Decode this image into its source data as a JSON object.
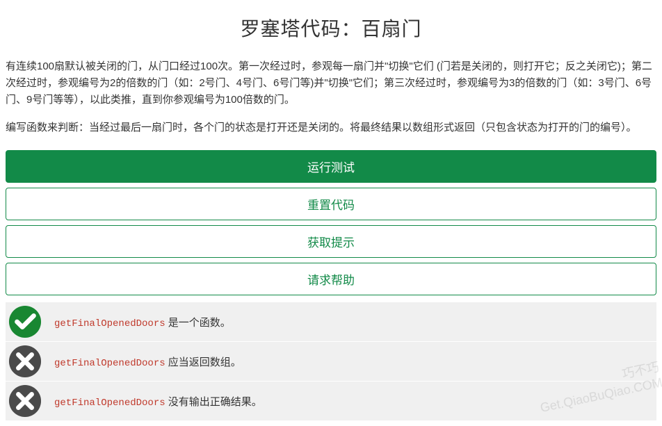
{
  "title": "罗塞塔代码：百扇门",
  "description": {
    "p1": "有连续100扇默认被关闭的门，从门口经过100次。第一次经过时，参观每一扇门并\"切换\"它们 (门若是关闭的，则打开它；反之关闭它)；第二次经过时，参观编号为2的倍数的门（如：2号门、4号门、6号门等)并\"切换\"它们；第三次经过时，参观编号为3的倍数的门（如：3号门、6号门、9号门等等），以此类推，直到你参观编号为100倍数的门。",
    "p2": "编写函数来判断：当经过最后一扇门时，各个门的状态是打开还是关闭的。将最终结果以数组形式返回（只包含状态为打开的门的编号）。"
  },
  "buttons": {
    "run": "运行测试",
    "reset": "重置代码",
    "hint": "获取提示",
    "help": "请求帮助"
  },
  "results": [
    {
      "status": "pass",
      "code": "getFinalOpenedDoors",
      "text": " 是一个函数。"
    },
    {
      "status": "fail",
      "code": "getFinalOpenedDoors",
      "text": " 应当返回数组。"
    },
    {
      "status": "fail",
      "code": "getFinalOpenedDoors",
      "text": " 没有输出正确结果。"
    }
  ],
  "watermark": {
    "line1": "巧不巧",
    "line2": "Get.QiaoBuQiao.COM"
  }
}
